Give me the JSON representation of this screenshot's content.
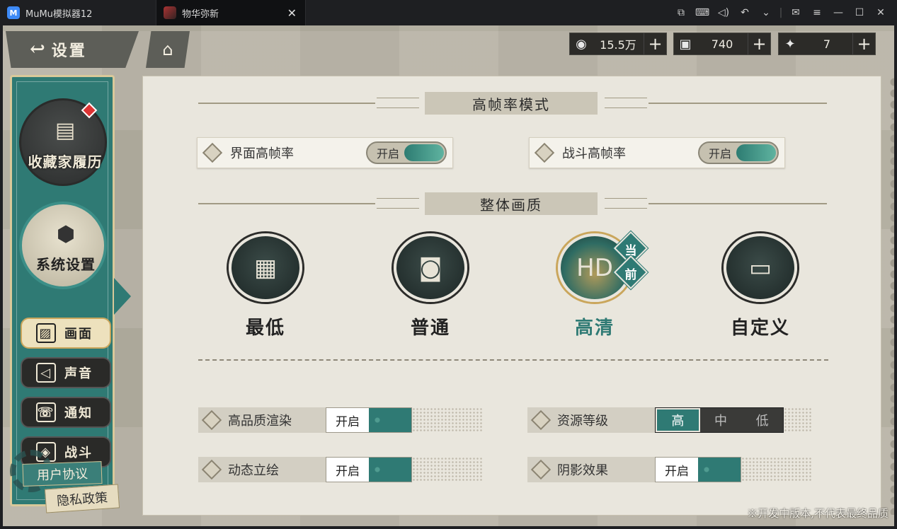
{
  "titlebar": {
    "tab_mumu": "MuMu模拟器12",
    "tab_game": "物华弥新",
    "tab_close": "✕",
    "icons": [
      "screen-record-icon",
      "keyboard-icon",
      "volume-icon",
      "undo-icon",
      "chevron-down-icon",
      "mail-icon",
      "menu-icon",
      "minimize-icon",
      "maximize-icon",
      "close-icon"
    ]
  },
  "header": {
    "back_label": "设置",
    "currencies": [
      {
        "icon": "coin-icon",
        "value": "15.5万",
        "plus": "+"
      },
      {
        "icon": "ticket-icon",
        "value": "740",
        "plus": "+"
      },
      {
        "icon": "gem-icon",
        "value": "7",
        "plus": "+"
      }
    ]
  },
  "sidebar": {
    "collector_label": "收藏家履历",
    "system_label": "系统设置",
    "items": [
      {
        "label": "画面",
        "icon": "image-icon",
        "active": true
      },
      {
        "label": "声音",
        "icon": "speaker-icon",
        "active": false
      },
      {
        "label": "通知",
        "icon": "phone-bell-icon",
        "active": false
      },
      {
        "label": "战斗",
        "icon": "battle-icon",
        "active": false
      }
    ],
    "user_agreement": "用户协议",
    "privacy": "隐私政策"
  },
  "panel": {
    "high_fps_title": "高帧率模式",
    "ui_fps_label": "界面高帧率",
    "ui_fps_state": "开启",
    "battle_fps_label": "战斗高帧率",
    "battle_fps_state": "开启",
    "quality_title": "整体画质",
    "quality_options": [
      {
        "label": "最低",
        "icon": "film-icon"
      },
      {
        "label": "普通",
        "icon": "camera-icon"
      },
      {
        "label": "高清",
        "icon": "hd-camera-icon",
        "current": true
      },
      {
        "label": "自定义",
        "icon": "custom-settings-icon"
      }
    ],
    "current_badge": [
      "当",
      "前"
    ],
    "hq_render_label": "高品质渲染",
    "hq_render_state": "开启",
    "dynamic_label": "动态立绘",
    "dynamic_state": "开启",
    "resource_label": "资源等级",
    "resource_options": [
      "高",
      "中",
      "低"
    ],
    "resource_selected": "高",
    "shadow_label": "阴影效果",
    "shadow_state": "开启"
  },
  "footnote": "※开发中版本,不代表最终品质",
  "colors": {
    "accent": "#2f7a74",
    "gold": "#caa65c",
    "panel": "#e9e6dd"
  }
}
